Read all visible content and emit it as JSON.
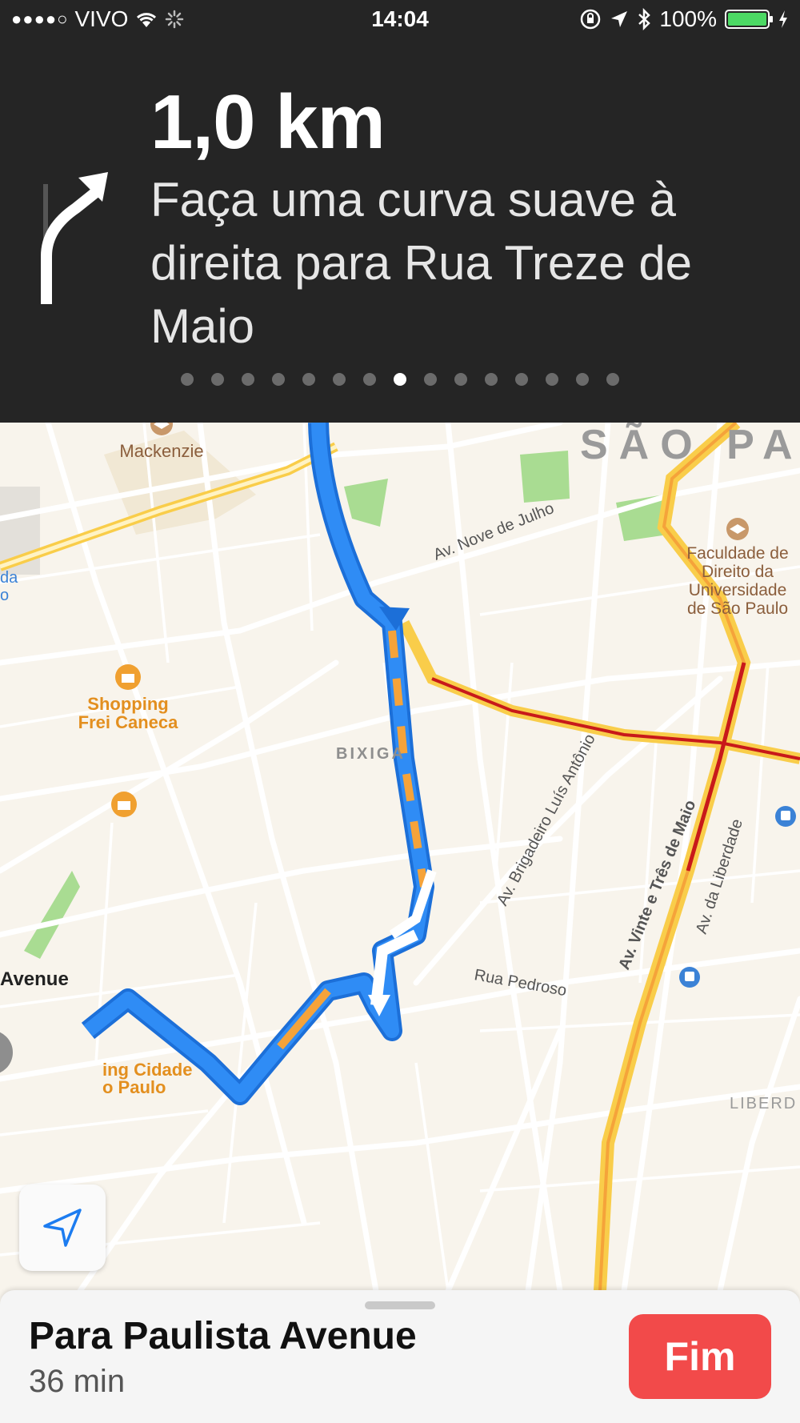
{
  "status_bar": {
    "signal": "●●●●○",
    "carrier": "VIVO",
    "time": "14:04",
    "battery": "100%",
    "icons": [
      "wifi-icon",
      "loading-icon",
      "orientation-lock-icon",
      "location-arrow-icon",
      "bluetooth-icon",
      "battery-icon",
      "charging-icon"
    ],
    "battery_level": 1.0,
    "battery_color": "#4cd964"
  },
  "navigation": {
    "distance": "1,0 km",
    "instruction": "Faça uma curva suave à direita para Rua Treze de Maio",
    "maneuver_icon": "slight-right-arrow-icon",
    "step_count": 15,
    "current_step": 8
  },
  "map": {
    "labels": {
      "mackenzie": "Mackenzie",
      "sao_paulo": "SÃO PA",
      "av_nove_de_julho": "Av. Nove de Julho",
      "faculdade_1": "Faculdade de",
      "faculdade_2": "Direito da",
      "faculdade_3": "Universidade",
      "faculdade_4": "de São Paulo",
      "shopping_frei_1": "Shopping",
      "shopping_frei_2": "Frei Caneca",
      "bixiga": "BIXIGA",
      "av_brigadeiro": "Av. Brigadeiro Luís Antônio",
      "av_vinte_e_tres": "Av. Vinte e Três de Maio",
      "av_liberdade": "Av. da Liberdade",
      "rua_pedroso": "Rua Pedroso",
      "avenue": "Avenue",
      "shopping_cidade_1": "ing Cidade",
      "shopping_cidade_2": "o Paulo",
      "liberdade": "LIBERD",
      "cut_left_1": "da",
      "cut_left_2": "o"
    },
    "colors": {
      "route": "#2f8cf5",
      "route_traffic": "#f5a33a",
      "highway": "#f9cd4a",
      "heavy_traffic": "#c8191a",
      "poi": "#f0a030",
      "park": "#a9dc92"
    }
  },
  "bottom_card": {
    "destination": "Para Paulista Avenue",
    "eta": "36 min",
    "end_button": "Fim"
  }
}
